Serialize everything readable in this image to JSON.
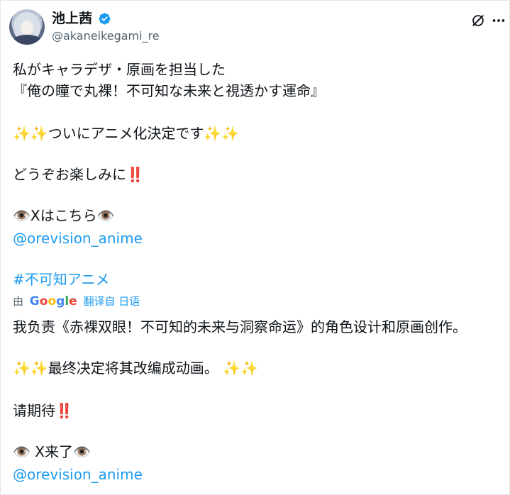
{
  "header": {
    "display_name": "池上茜",
    "handle": "@akaneikegami_re"
  },
  "tweet": {
    "line1": "私がキャラデザ・原画を担当した",
    "line2": "『俺の瞳で丸裸！不可知な未来と視透かす運命』",
    "line3": "✨✨ついにアニメ化決定です✨✨",
    "line4": "どうぞお楽しみに‼️",
    "line5": "👁️Xはこちら👁️",
    "mention1": "@orevision_anime",
    "hashtag": "#不可知アニメ"
  },
  "translation": {
    "by_label": "由",
    "provider": "Google",
    "translated_from": "翻译自 日语",
    "line1": "我负责《赤裸双眼！不可知的未来与洞察命运》的角色设计和原画创作。",
    "line2": "✨✨最终决定将其改编成动画。 ✨✨",
    "line3": "请期待‼️",
    "line4": "👁️ X来了👁️",
    "mention": "@orevision_anime"
  },
  "icons": {
    "verified": "verified-badge-icon",
    "grok": "grok-icon",
    "more": "more-options-icon"
  },
  "colors": {
    "link": "#1d9bf0",
    "verified": "#1d9bf0",
    "text": "#0f1419",
    "secondary": "#536471"
  }
}
